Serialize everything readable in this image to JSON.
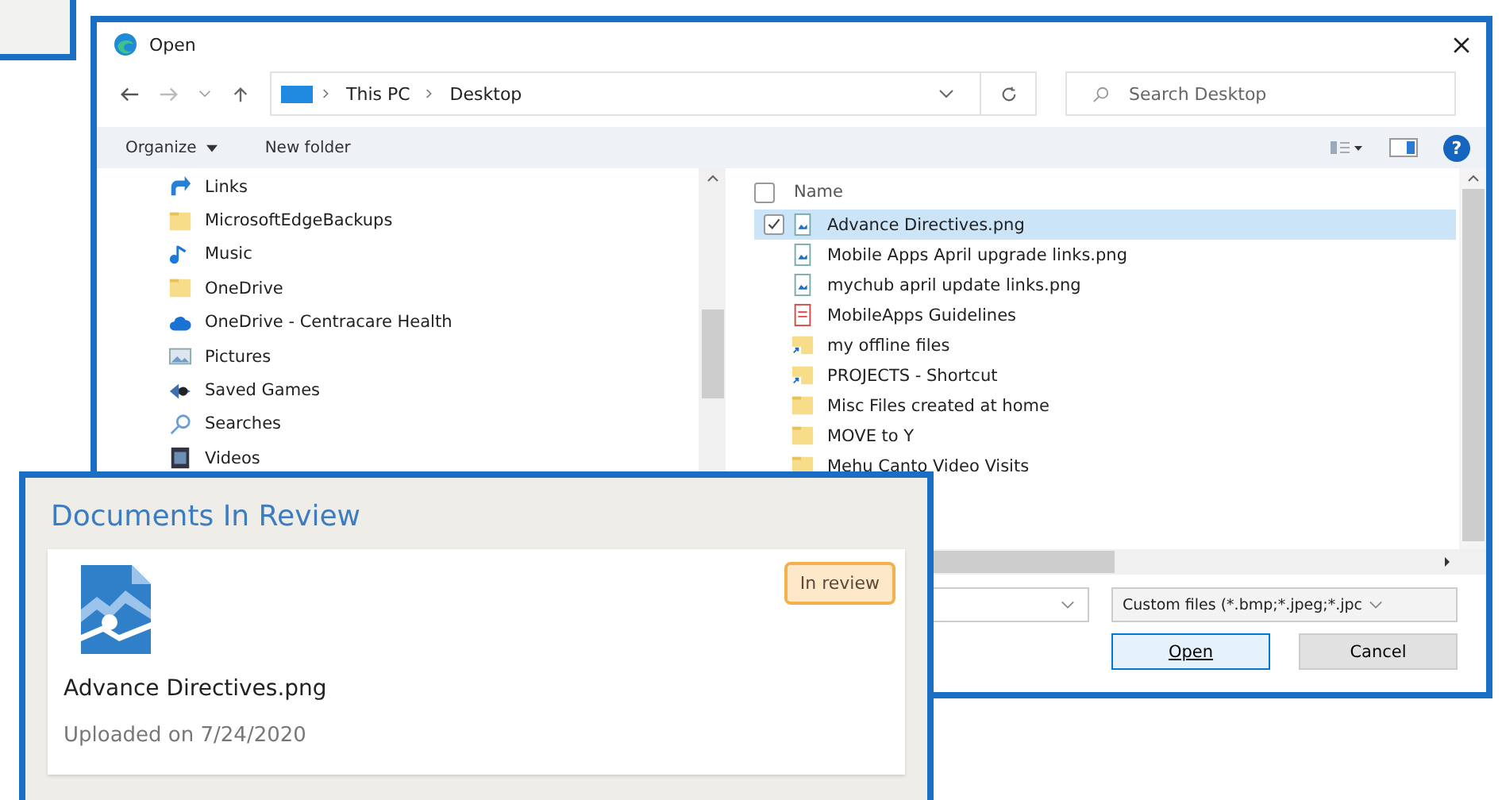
{
  "dialog": {
    "title": "Open",
    "breadcrumb": [
      "This PC",
      "Desktop"
    ],
    "search": {
      "placeholder": "Search Desktop"
    },
    "toolbar": [
      {
        "label": "Organize",
        "kind": "menu"
      },
      {
        "label": "New folder",
        "kind": "plain"
      }
    ],
    "nav_items": [
      {
        "label": "Links",
        "kind": "links"
      },
      {
        "label": "MicrosoftEdgeBackups",
        "kind": "folder"
      },
      {
        "label": "Music",
        "kind": "music"
      },
      {
        "label": "OneDrive",
        "kind": "folder"
      },
      {
        "label": "OneDrive - Centracare Health",
        "kind": "cloud"
      },
      {
        "label": "Pictures",
        "kind": "pictures"
      },
      {
        "label": "Saved Games",
        "kind": "games"
      },
      {
        "label": "Searches",
        "kind": "search"
      },
      {
        "label": "Videos",
        "kind": "videos"
      }
    ],
    "column": {
      "label": "Name",
      "checked": false
    },
    "files": [
      {
        "name": "Advance Directives.png",
        "kind": "image",
        "selected": true,
        "checked": true
      },
      {
        "name": "Mobile Apps April upgrade links.png",
        "kind": "image",
        "selected": false,
        "checked": false
      },
      {
        "name": "mychub april update links.png",
        "kind": "image",
        "selected": false,
        "checked": false
      },
      {
        "name": "MobileApps Guidelines",
        "kind": "pdf",
        "selected": false,
        "checked": false
      },
      {
        "name": "my offline files",
        "kind": "shortcut",
        "selected": false,
        "checked": false
      },
      {
        "name": "PROJECTS - Shortcut",
        "kind": "shortcut",
        "selected": false,
        "checked": false
      },
      {
        "name": "Misc Files created at home",
        "kind": "folder",
        "selected": false,
        "checked": false
      },
      {
        "name": "MOVE to Y",
        "kind": "folder",
        "selected": false,
        "checked": false
      },
      {
        "name": "Mehu Canto Video Visits",
        "kind": "folder",
        "selected": false,
        "checked": false
      }
    ],
    "file_type": "Custom files (*.bmp;*.jpeg;*.jpc",
    "buttons": [
      {
        "label": "Open",
        "kind": "default"
      },
      {
        "label": "Cancel",
        "kind": "normal"
      }
    ],
    "help": "?"
  },
  "review_panel": {
    "title": "Documents In Review",
    "document": {
      "name": "Advance Directives.png",
      "status": "In review",
      "uploaded": "Uploaded on 7/24/2020"
    }
  }
}
